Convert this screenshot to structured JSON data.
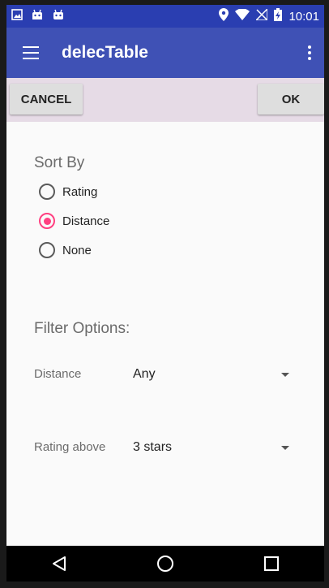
{
  "status_bar": {
    "time": "10:01",
    "left_icons": [
      "image-icon",
      "android-icon",
      "android-icon"
    ],
    "right_icons": [
      "location-icon",
      "wifi-icon",
      "no-signal-icon",
      "battery-charging-icon"
    ]
  },
  "app_bar": {
    "title": "delecTable",
    "color": "#3f51b5"
  },
  "actions": {
    "cancel_label": "CANCEL",
    "ok_label": "OK"
  },
  "sort": {
    "title": "Sort By",
    "options": [
      {
        "label": "Rating",
        "checked": false
      },
      {
        "label": "Distance",
        "checked": true
      },
      {
        "label": "None",
        "checked": false
      }
    ],
    "accent": "#ff4081"
  },
  "filter": {
    "title": "Filter Options:",
    "distance_label": "Distance",
    "distance_value": "Any",
    "rating_label": "Rating above",
    "rating_value": "3 stars"
  },
  "nav_bar": {
    "buttons": [
      "back-icon",
      "home-icon",
      "recents-icon"
    ]
  }
}
